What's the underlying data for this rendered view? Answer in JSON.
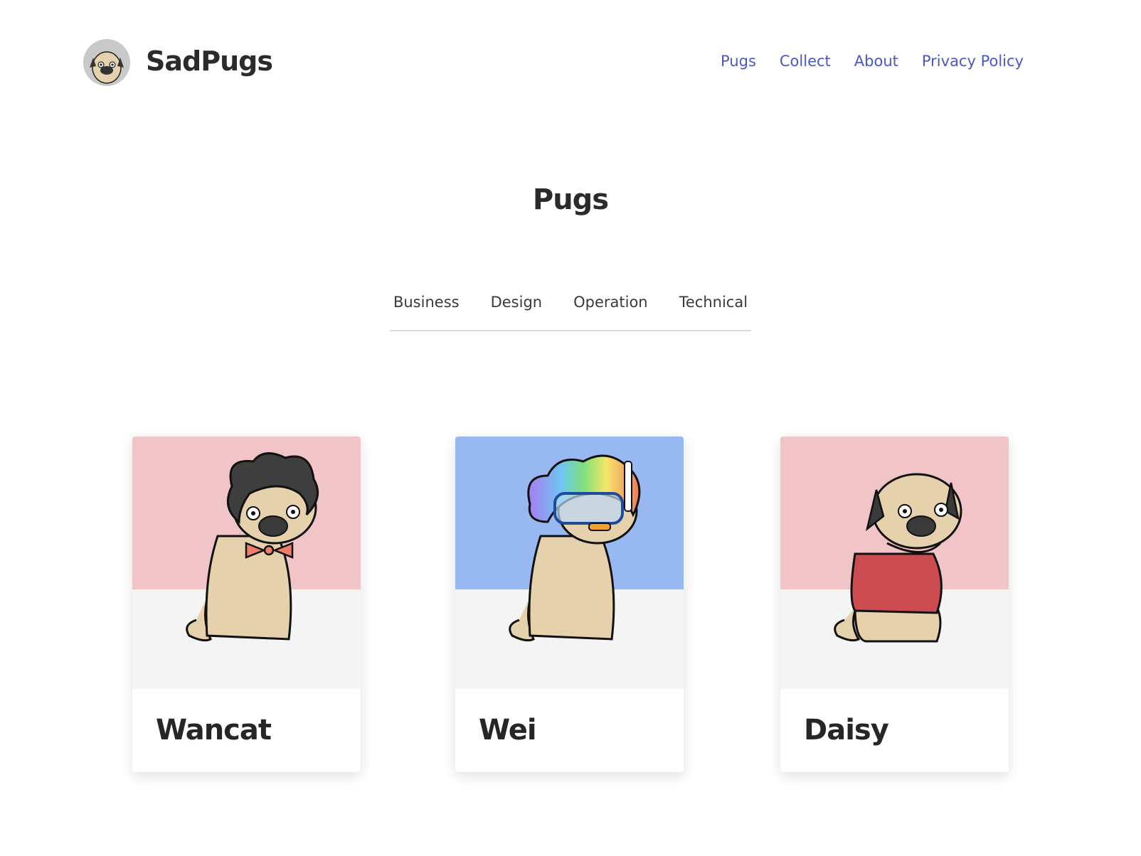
{
  "brand": {
    "name": "SadPugs",
    "logo_icon": "pug-avatar-icon"
  },
  "nav": {
    "items": [
      "Pugs",
      "Collect",
      "About",
      "Privacy Policy"
    ],
    "link_color": "#4a59c2"
  },
  "page": {
    "title": "Pugs"
  },
  "tabs": [
    "Business",
    "Design",
    "Operation",
    "Technical"
  ],
  "cards": [
    {
      "name": "Wancat",
      "bg_color": "#f1c4c8",
      "accessory": "black-afro-red-bowtie"
    },
    {
      "name": "Wei",
      "bg_color": "#98b8f2",
      "accessory": "rainbow-afro-snorkel-goggles"
    },
    {
      "name": "Daisy",
      "bg_color": "#f1c4c8",
      "accessory": "red-hoodie"
    }
  ]
}
